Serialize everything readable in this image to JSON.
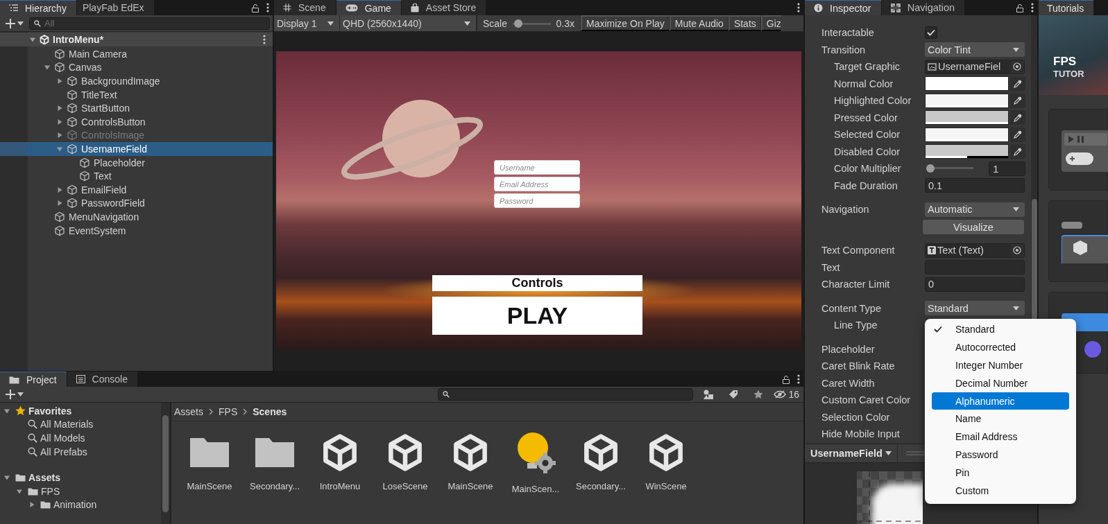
{
  "hierarchy": {
    "tabs": [
      {
        "label": "Hierarchy",
        "selected": true
      },
      {
        "label": "PlayFab EdEx",
        "selected": false
      }
    ],
    "search": {
      "placeholder": "All"
    },
    "scene": {
      "name": "IntroMenu*",
      "expanded": true,
      "children": [
        {
          "name": "Main Camera",
          "selected": false,
          "disabled": false
        },
        {
          "name": "Canvas",
          "expanded": true,
          "selected": false,
          "disabled": false,
          "children": [
            {
              "name": "BackgroundImage",
              "expanded": false,
              "selected": false,
              "disabled": false
            },
            {
              "name": "TitleText",
              "selected": false,
              "disabled": false
            },
            {
              "name": "StartButton",
              "expanded": false,
              "selected": false,
              "disabled": false
            },
            {
              "name": "ControlsButton",
              "expanded": false,
              "selected": false,
              "disabled": false
            },
            {
              "name": "ControlsImage",
              "expanded": false,
              "selected": false,
              "disabled": true
            },
            {
              "name": "UsernameField",
              "expanded": true,
              "selected": true,
              "disabled": false,
              "children": [
                {
                  "name": "Placeholder",
                  "selected": false,
                  "disabled": false
                },
                {
                  "name": "Text",
                  "selected": false,
                  "disabled": false
                }
              ]
            },
            {
              "name": "EmailField",
              "expanded": false,
              "selected": false,
              "disabled": false
            },
            {
              "name": "PasswordField",
              "expanded": false,
              "selected": false,
              "disabled": false
            }
          ]
        },
        {
          "name": "MenuNavigation",
          "selected": false,
          "disabled": false
        },
        {
          "name": "EventSystem",
          "selected": false,
          "disabled": false
        }
      ]
    }
  },
  "game": {
    "tabs": [
      {
        "label": "Scene",
        "selected": false
      },
      {
        "label": "Game",
        "selected": true
      },
      {
        "label": "Asset Store",
        "selected": false
      }
    ],
    "toolbar": {
      "display": "Display 1",
      "resolution": "QHD (2560x1440)",
      "scale_label": "Scale",
      "scale": {
        "level": 0.05,
        "reading": "0.3x"
      },
      "buttons": [
        "Maximize On Play",
        "Mute Audio",
        "Stats",
        "Giz"
      ]
    },
    "view": {
      "fields": [
        {
          "placeholder": "Username"
        },
        {
          "placeholder": "Email Address"
        },
        {
          "placeholder": "Password"
        }
      ],
      "buttons": [
        {
          "label": "Controls",
          "kind": "small"
        },
        {
          "label": "PLAY",
          "kind": "large"
        }
      ]
    }
  },
  "inspector": {
    "tabs": [
      {
        "label": "Inspector",
        "selected": true
      },
      {
        "label": "Navigation",
        "selected": false
      }
    ],
    "sections": [
      {
        "properties": [
          {
            "kind": "checkbox",
            "label": "Interactable",
            "checked": true
          },
          {
            "kind": "dropdown",
            "label": "Transition",
            "value": "Color Tint",
            "children": [
              {
                "kind": "image_reference",
                "label": "Target Graphic",
                "value": "UsernameFiel"
              },
              {
                "kind": "color",
                "label": "Normal Color",
                "color": "#ffffff",
                "level": 1
              },
              {
                "kind": "color",
                "label": "Highlighted Color",
                "color": "#f5f5f5",
                "level": 1
              },
              {
                "kind": "color",
                "label": "Pressed Color",
                "color": "#c8c8c8",
                "level": 1
              },
              {
                "kind": "color",
                "label": "Selected Color",
                "color": "#f5f5f5",
                "level": 1
              },
              {
                "kind": "color",
                "label": "Disabled Color",
                "color": "#c8c8c8",
                "level": 0.5
              },
              {
                "kind": "slider",
                "label": "Color Multiplier",
                "level": 0,
                "value": "1"
              },
              {
                "kind": "field",
                "label": "Fade Duration",
                "value": "0.1"
              }
            ]
          }
        ]
      },
      {
        "properties": [
          {
            "kind": "dropdown",
            "label": "Navigation",
            "value": "Automatic"
          },
          {
            "kind": "button",
            "value": "Visualize"
          }
        ]
      },
      {
        "properties": [
          {
            "kind": "text_reference",
            "label": "Text Component",
            "value": "Text (Text)"
          },
          {
            "kind": "field",
            "label": "Text"
          },
          {
            "kind": "field",
            "label": "Character Limit",
            "value": "0"
          }
        ]
      },
      {
        "properties": [
          {
            "kind": "dropdown",
            "label": "Content Type",
            "value": "Standard",
            "children": [
              {
                "kind": "label",
                "label": "Line Type"
              }
            ]
          }
        ]
      },
      {
        "properties": [
          {
            "kind": "label",
            "label": "Placeholder"
          },
          {
            "kind": "label",
            "label": "Caret Blink Rate"
          },
          {
            "kind": "label",
            "label": "Caret Width"
          },
          {
            "kind": "label",
            "label": "Custom Caret Color"
          },
          {
            "kind": "label",
            "label": "Selection Color"
          },
          {
            "kind": "label",
            "label": "Hide Mobile Input"
          }
        ]
      }
    ],
    "preview": {
      "title": "UsernameField"
    }
  },
  "popup": {
    "options": [
      {
        "label": "Standard",
        "checked": true,
        "highlighted": false
      },
      {
        "label": "Autocorrected",
        "checked": false,
        "highlighted": false
      },
      {
        "label": "Integer Number",
        "checked": false,
        "highlighted": false
      },
      {
        "label": "Decimal Number",
        "checked": false,
        "highlighted": false
      },
      {
        "label": "Alphanumeric",
        "checked": false,
        "highlighted": true
      },
      {
        "label": "Name",
        "checked": false,
        "highlighted": false
      },
      {
        "label": "Email Address",
        "checked": false,
        "highlighted": false
      },
      {
        "label": "Password",
        "checked": false,
        "highlighted": false
      },
      {
        "label": "Pin",
        "checked": false,
        "highlighted": false
      },
      {
        "label": "Custom",
        "checked": false,
        "highlighted": false
      }
    ]
  },
  "project": {
    "tabs": [
      {
        "label": "Project",
        "selected": true
      },
      {
        "label": "Console",
        "selected": false
      }
    ],
    "hidden_count": "16",
    "tree": [
      {
        "kind": "favorites",
        "label": "Favorites",
        "expanded": true,
        "children": [
          {
            "kind": "search",
            "label": "All Materials"
          },
          {
            "kind": "search",
            "label": "All Models"
          },
          {
            "kind": "search",
            "label": "All Prefabs"
          }
        ]
      },
      {
        "kind": "folder",
        "label": "Assets",
        "expanded": true,
        "children": [
          {
            "kind": "folder",
            "label": "FPS",
            "expanded": true,
            "children": [
              {
                "kind": "folder",
                "label": "Animation",
                "expanded": false
              }
            ]
          }
        ]
      }
    ],
    "breadcrumb": [
      "Assets",
      "FPS",
      "Scenes"
    ],
    "assets": [
      {
        "kind": "folder",
        "label": "MainScene"
      },
      {
        "kind": "folder",
        "label": "Secondary..."
      },
      {
        "kind": "scene",
        "label": "IntroMenu"
      },
      {
        "kind": "scene",
        "label": "LoseScene"
      },
      {
        "kind": "scene",
        "label": "MainScene"
      },
      {
        "kind": "lighting",
        "label": "MainScen..."
      },
      {
        "kind": "scene",
        "label": "Secondary..."
      },
      {
        "kind": "scene",
        "label": "WinScene"
      }
    ]
  },
  "tutorials": {
    "tab": "Tutorials",
    "banner": {
      "title": "FPS",
      "subtitle": "TUTOR"
    }
  }
}
